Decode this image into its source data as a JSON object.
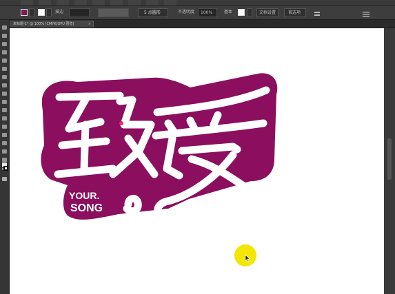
{
  "document_tab": {
    "label": "未标题-1* @ 100% (CMYK/GPU 预览)",
    "close_symbol": "×"
  },
  "control_bar": {
    "fill_color": "#7b1c52",
    "stroke_label": "描边",
    "style_label": "基本",
    "opacity_label": "不透明度",
    "opacity_value": "100%",
    "style_dropdown_label": "5 点圆形",
    "doc_setup_label": "文档设置",
    "prefs_label": "首选项"
  },
  "artwork": {
    "logo_text_main": "致爱",
    "logo_text_sub_line1": "YOUR.",
    "logo_text_sub_line2": "SONG",
    "badge_color": "#8b0f5e",
    "letter_color": "#ffffff"
  },
  "cursor": {
    "highlight_color": "#f3e600"
  }
}
